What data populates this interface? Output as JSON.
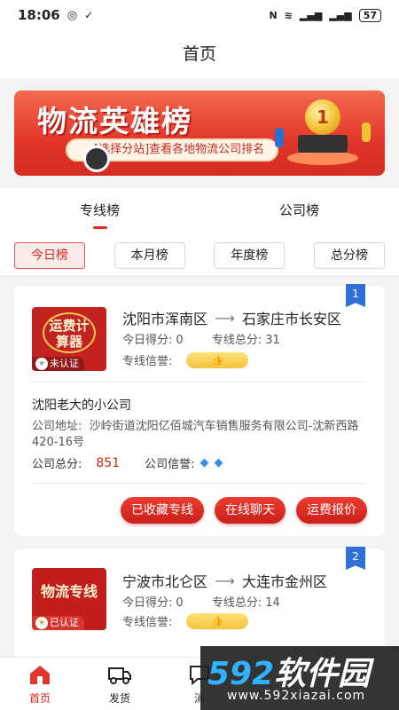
{
  "status_bar": {
    "time": "18:06",
    "battery": "57"
  },
  "header": {
    "title": "首页"
  },
  "banner": {
    "title": "物流英雄榜",
    "subtitle": "[选择分站]查看各地物流公司排名",
    "trophy_rank": "1"
  },
  "main_tabs": [
    {
      "label": "专线榜",
      "active": true
    },
    {
      "label": "公司榜",
      "active": false
    }
  ],
  "sub_tabs": [
    {
      "label": "今日榜",
      "active": true
    },
    {
      "label": "本月榜",
      "active": false
    },
    {
      "label": "年度榜",
      "active": false
    },
    {
      "label": "总分榜",
      "active": false
    }
  ],
  "cards": [
    {
      "rank": "1",
      "logo_text": "运费计算器",
      "auth_status": "未认证",
      "from": "沈阳市浑南区",
      "to": "石家庄市长安区",
      "today_score_label": "今日得分:",
      "today_score": "0",
      "line_total_label": "专线总分:",
      "line_total": "31",
      "credit_label": "专线信誉:",
      "company_name": "沈阳老大的小公司",
      "address_label": "公司地址:",
      "address": "沙岭街道沈阳亿佰城汽车销售服务有限公司-沈新西路420-16号",
      "company_total_label": "公司总分:",
      "company_total": "851",
      "company_credit_label": "公司信誉:",
      "actions": [
        "已收藏专线",
        "在线聊天",
        "运费报价"
      ]
    },
    {
      "rank": "2",
      "logo_text": "物流专线",
      "auth_status": "已认证",
      "from": "宁波市北仑区",
      "to": "大连市金州区",
      "today_score_label": "今日得分:",
      "today_score": "0",
      "line_total_label": "专线总分:",
      "line_total": "14",
      "credit_label": "专线信誉:"
    }
  ],
  "bottom_nav": [
    {
      "label": "首页",
      "icon": "home-icon",
      "active": true
    },
    {
      "label": "发货",
      "icon": "truck-icon",
      "active": false
    },
    {
      "label": "消",
      "icon": "message-icon",
      "active": false
    }
  ],
  "watermark": {
    "brand_num": "592",
    "brand_text": "软件园",
    "url": "www.592xiazai.com"
  },
  "colors": {
    "accent": "#e02a22",
    "rank_badge": "#2f6fd6",
    "score": "#c9251d"
  }
}
